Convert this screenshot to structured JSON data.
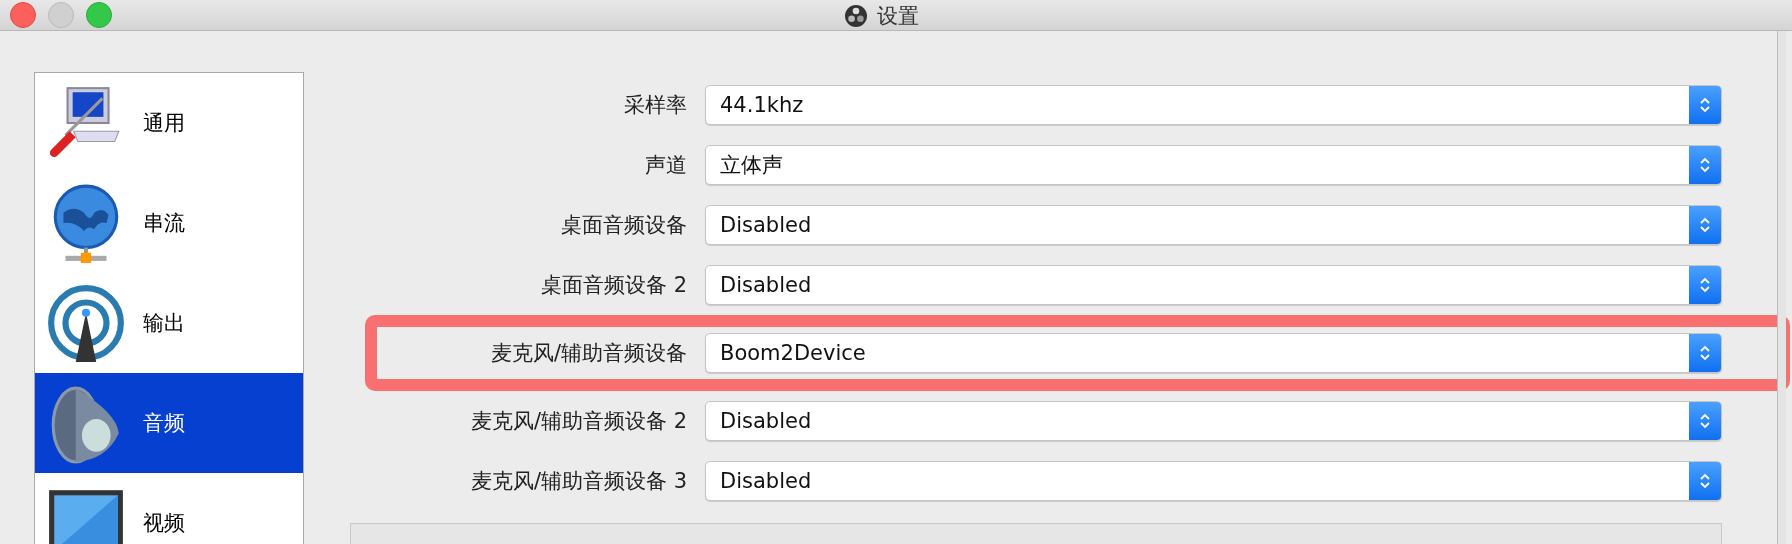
{
  "window": {
    "title": "设置"
  },
  "sidebar": {
    "items": [
      {
        "label": "通用",
        "kind": "general",
        "selected": false
      },
      {
        "label": "串流",
        "kind": "stream",
        "selected": false
      },
      {
        "label": "输出",
        "kind": "output",
        "selected": false
      },
      {
        "label": "音频",
        "kind": "audio",
        "selected": true
      },
      {
        "label": "视频",
        "kind": "video",
        "selected": false
      }
    ]
  },
  "form": {
    "rows": [
      {
        "label": "采样率",
        "value": "44.1khz",
        "highlighted": false
      },
      {
        "label": "声道",
        "value": "立体声",
        "highlighted": false
      },
      {
        "label": "桌面音频设备",
        "value": "Disabled",
        "highlighted": false
      },
      {
        "label": "桌面音频设备 2",
        "value": "Disabled",
        "highlighted": false
      },
      {
        "label": "麦克风/辅助音频设备",
        "value": "Boom2Device",
        "highlighted": true
      },
      {
        "label": "麦克风/辅助音频设备 2",
        "value": "Disabled",
        "highlighted": false
      },
      {
        "label": "麦克风/辅助音频设备 3",
        "value": "Disabled",
        "highlighted": false
      }
    ]
  }
}
